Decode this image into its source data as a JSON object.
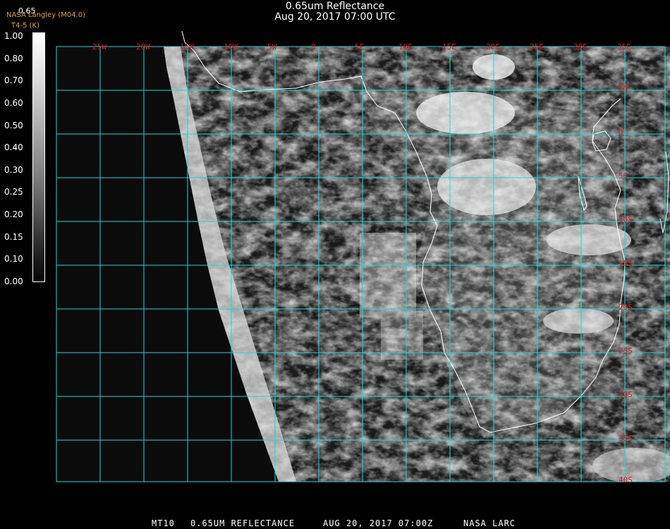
{
  "header": {
    "title": "0.65um Reflectance",
    "datetime": "Aug 20, 2017 07:00 UTC",
    "credit": "NASA Langley (M04.0)",
    "credit_sub": "T4-5 (K)",
    "colorbar_top_value": "0.65"
  },
  "colorbar": {
    "labels": [
      "1.00",
      "0.80",
      "0.70",
      "0.60",
      "0.50",
      "0.40",
      "0.30",
      "0.25",
      "0.20",
      "0.15",
      "0.10",
      "0.00"
    ]
  },
  "grid": {
    "longitudes": [
      "25W",
      "20W",
      "15W",
      "10W",
      "5W",
      "0",
      "5E",
      "10E",
      "15E",
      "20E",
      "25E",
      "30E",
      "35E"
    ],
    "latitudes": [
      "5N",
      "0",
      "5S",
      "10S",
      "15S",
      "20S",
      "25S",
      "30S",
      "35S",
      "40S"
    ]
  },
  "footer": {
    "sat": "MT10",
    "product": "0.65UM REFLECTANCE",
    "date": "AUG 20, 2017 07:00Z",
    "org": "NASA LARC"
  },
  "colors": {
    "grid": "#19d9d9",
    "label": "#e01a1a",
    "coast": "#ffffff",
    "credit": "#e8a23a"
  }
}
